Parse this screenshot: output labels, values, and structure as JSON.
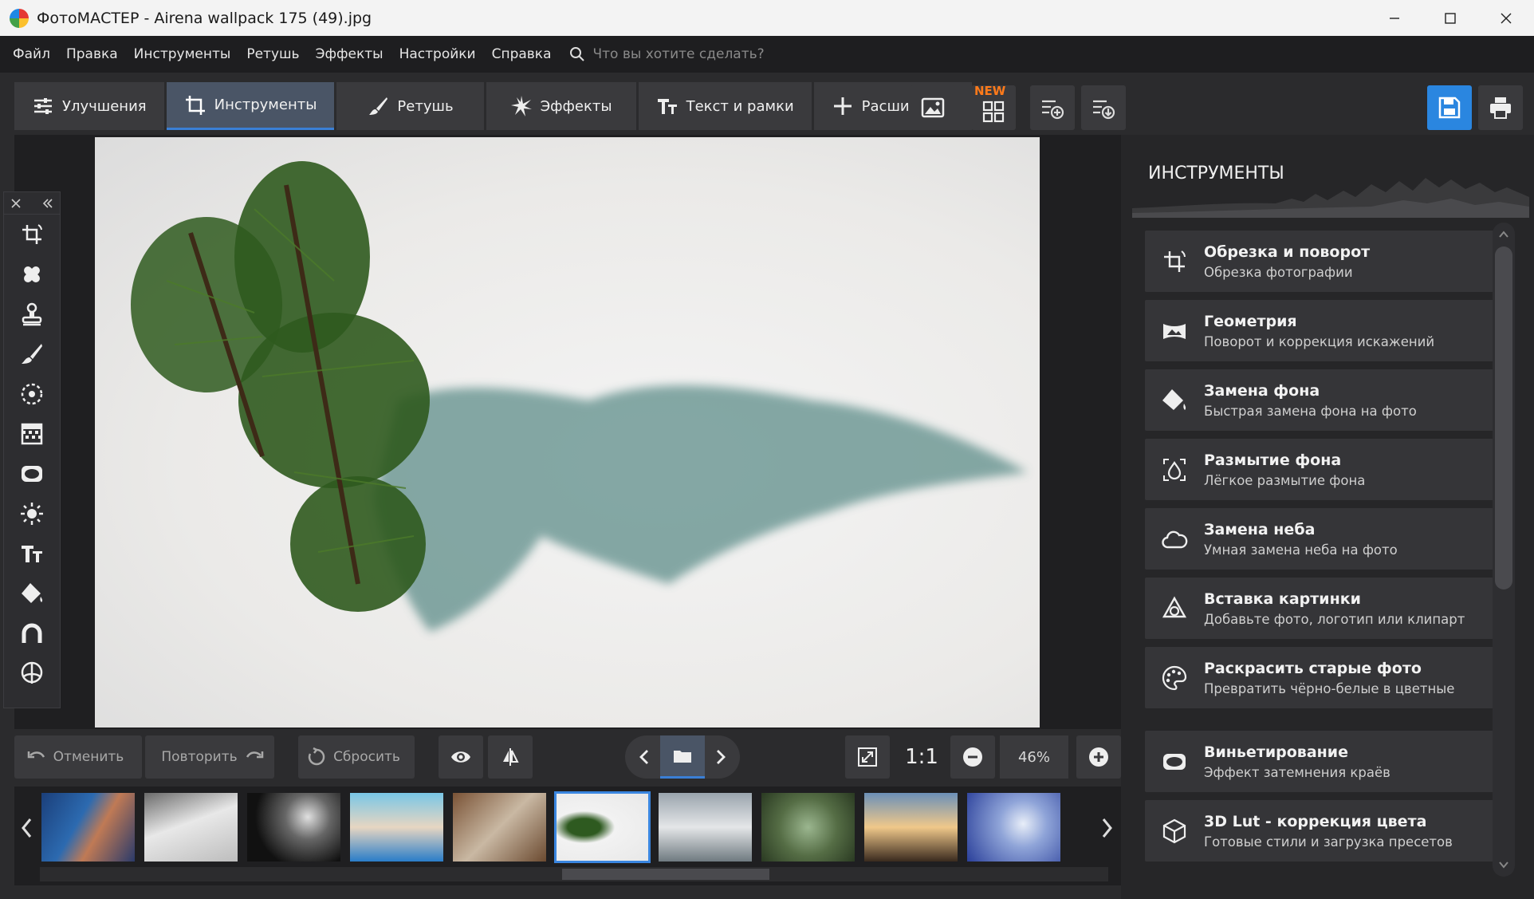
{
  "window": {
    "title": "ФотоМАСТЕР - Airena wallpack 175 (49).jpg",
    "controls": [
      "minimize-icon",
      "maximize-icon",
      "close-icon"
    ]
  },
  "menu": {
    "items": [
      "Файл",
      "Правка",
      "Инструменты",
      "Ретушь",
      "Эффекты",
      "Настройки",
      "Справка"
    ],
    "search_placeholder": "Что вы хотите сделать?"
  },
  "toolbar": {
    "tabs": [
      {
        "label": "Улучшения",
        "icon": "sliders-icon",
        "active": false
      },
      {
        "label": "Инструменты",
        "icon": "crop-icon",
        "active": true
      },
      {
        "label": "Ретушь",
        "icon": "brush-icon",
        "active": false
      },
      {
        "label": "Эффекты",
        "icon": "sparkle-icon",
        "active": false
      },
      {
        "label": "Текст и рамки",
        "icon": "text-icon",
        "active": false
      },
      {
        "label": "Расширения",
        "icon": "plus-icon",
        "active": false
      }
    ],
    "new_badge": "NEW",
    "accent": "#2a86e0"
  },
  "bottom": {
    "undo_label": "Отменить",
    "redo_label": "Повторить",
    "reset_label": "Сбросить",
    "ratio_label": "1:1",
    "zoom_value": "46%"
  },
  "right_panel": {
    "title": "ИНСТРУМЕНТЫ",
    "tools": [
      {
        "title": "Обрезка и поворот",
        "subtitle": "Обрезка фотографии",
        "icon": "crop-rotate-icon"
      },
      {
        "title": "Геометрия",
        "subtitle": "Поворот и коррекция искажений",
        "icon": "geometry-icon"
      },
      {
        "title": "Замена фона",
        "subtitle": "Быстрая замена фона на фото",
        "icon": "paint-bucket-icon"
      },
      {
        "title": "Размытие фона",
        "subtitle": "Лёгкое размытие фона",
        "icon": "blur-drop-icon"
      },
      {
        "title": "Замена неба",
        "subtitle": "Умная замена неба на фото",
        "icon": "cloud-icon"
      },
      {
        "title": "Вставка картинки",
        "subtitle": "Добавьте фото, логотип или клипарт",
        "icon": "shapes-icon"
      },
      {
        "title": "Раскрасить старые фото",
        "subtitle": "Превратить чёрно-белые в цветные",
        "icon": "palette-icon"
      },
      {
        "title": "Виньетирование",
        "subtitle": "Эффект затемнения краёв",
        "icon": "vignette-icon"
      },
      {
        "title": "3D Lut - коррекция цвета",
        "subtitle": "Готовые стили и загрузка пресетов",
        "icon": "cube-icon"
      }
    ]
  }
}
